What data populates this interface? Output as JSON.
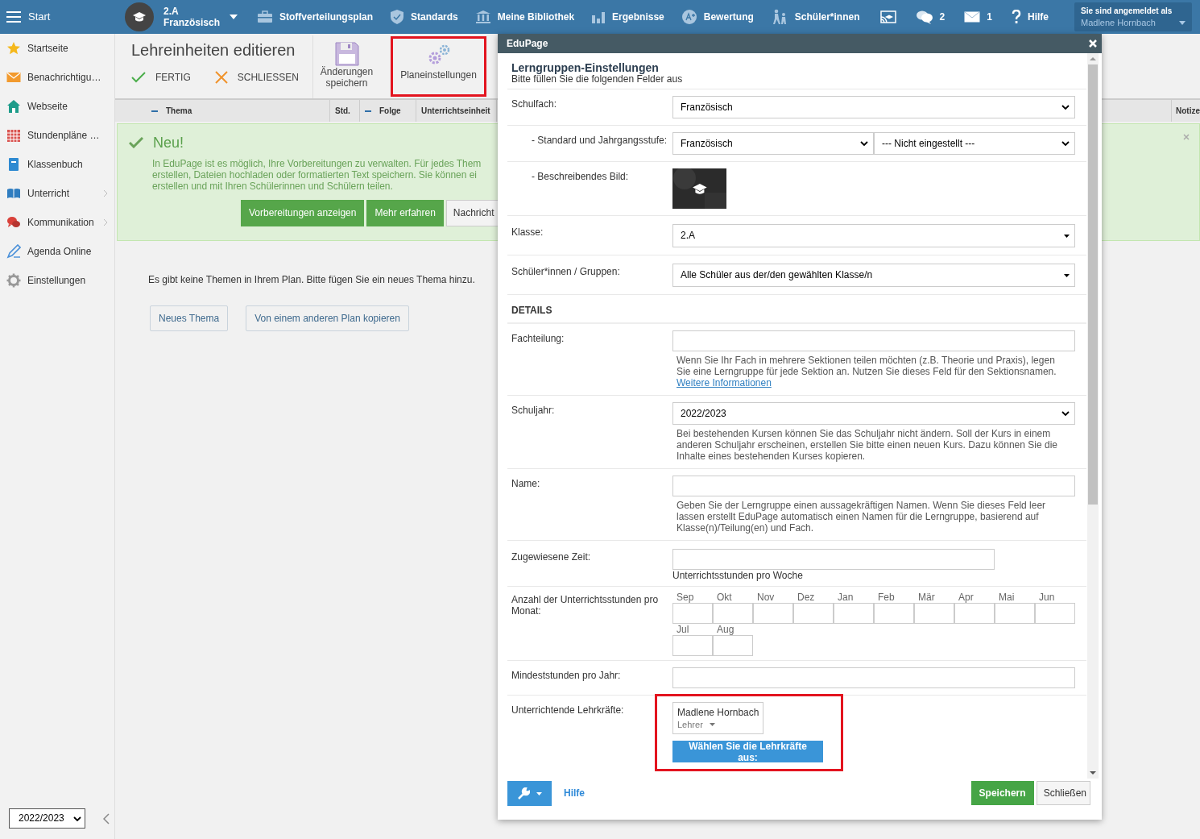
{
  "topbar": {
    "menu_label": "Start",
    "class_selector": {
      "line1": "2.A",
      "line2": "Französisch"
    },
    "nav": [
      {
        "label": "Stoffverteilungsplan"
      },
      {
        "label": "Standards"
      },
      {
        "label": "Meine Bibliothek"
      },
      {
        "label": "Ergebnisse"
      },
      {
        "label": "Bewertung"
      },
      {
        "label": "Schüler*innen"
      }
    ],
    "messages_count": "2",
    "mail_count": "1",
    "help_label": "Hilfe",
    "account": {
      "caption": "Sie sind angemeldet als",
      "user": "Madlene Hornbach"
    }
  },
  "sidebar": {
    "items": [
      {
        "label": "Startseite",
        "has_submenu": false
      },
      {
        "label": "Benachrichtigu…",
        "has_submenu": false
      },
      {
        "label": "Webseite",
        "has_submenu": false
      },
      {
        "label": "Stundenpläne …",
        "has_submenu": false
      },
      {
        "label": "Klassenbuch",
        "has_submenu": false
      },
      {
        "label": "Unterricht",
        "has_submenu": true
      },
      {
        "label": "Kommunikation",
        "has_submenu": true
      },
      {
        "label": "Agenda Online",
        "has_submenu": false
      },
      {
        "label": "Einstellungen",
        "has_submenu": false
      }
    ],
    "year_select": "2022/2023"
  },
  "toolbar": {
    "title": "Lehreinheiten editieren",
    "done": "FERTIG",
    "close": "SCHLIESSEN",
    "save": "Änderungen speichern",
    "plan_settings": {
      "label": "Planeinstellungen",
      "highlighted": true
    }
  },
  "table_header": {
    "columns": [
      {
        "label": "Thema",
        "collapse": true
      },
      {
        "label": "Std.",
        "collapse": false
      },
      {
        "label": "Folge",
        "collapse": true
      },
      {
        "label": "Unterrichtseinheit",
        "collapse": false
      }
    ],
    "last_column": "Notize"
  },
  "banner": {
    "title": "Neu!",
    "lines": [
      "In EduPage ist es möglich, Ihre Vorbereitungen zu verwalten. Für jedes Them",
      "erstellen, Dateien hochladen oder formatierten Text speichern. Sie können ei",
      "erstellen und mit Ihren Schülerinnen und Schülern teilen."
    ],
    "buttons": [
      {
        "label": "Vorbereitungen anzeigen",
        "kind": "primary"
      },
      {
        "label": "Mehr erfahren",
        "kind": "primary"
      },
      {
        "label": "Nachricht",
        "kind": "secondary"
      }
    ]
  },
  "empty_message": "Es gibt keine Themen in Ihrem Plan. Bitte fügen Sie ein neues Thema hinzu.",
  "actions": [
    "Neues Thema",
    "Von einem anderen Plan kopieren"
  ],
  "dialog": {
    "title": "EduPage",
    "heading": "Lerngruppen-Einstellungen",
    "subheading": "Bitte füllen Sie die folgenden Felder aus",
    "rows": [
      {
        "kind": "select",
        "label": "Schulfach:",
        "value": "Französisch",
        "children": [
          {
            "kind": "select_pair",
            "label": "- Standard und Jahrgangsstufe:",
            "values": [
              "Französisch",
              "--- Nicht eingestellt ---"
            ]
          },
          {
            "label": "- Beschreibendes Bild:"
          }
        ]
      },
      {
        "kind": "combo",
        "label": "Klasse:",
        "value": "2.A"
      },
      {
        "kind": "combo",
        "label": "Schüler*innen / Gruppen:",
        "value": "Alle Schüler aus der/den gewählten Klasse/n"
      },
      {
        "kind": "heading",
        "label": "DETAILS"
      },
      {
        "kind": "text",
        "label": "Fachteilung:",
        "help": "Wenn Sie Ihr Fach in mehrere Sektionen teilen möchten (z.B. Theorie und Praxis), legen Sie eine Lerngruppe für jede Sektion an. Nutzen Sie dieses Feld für den Sektionsnamen.",
        "link": "Weitere Informationen"
      },
      {
        "kind": "select",
        "label": "Schuljahr:",
        "value": "2022/2023",
        "help": "Bei bestehenden Kursen können Sie das Schuljahr nicht ändern. Soll der Kurs in einem anderen Schuljahr erscheinen, erstellen Sie bitte einen neuen Kurs. Dazu können Sie die Inhalte eines bestehenden Kurses kopieren."
      },
      {
        "kind": "text",
        "label": "Name:",
        "help": "Geben Sie der Lerngruppe einen aussagekräftigen Namen. Wenn Sie dieses Feld leer lassen erstellt EduPage automatisch einen Namen für die Lerngruppe, basierend auf Klasse(n)/Teilung(en) und Fach."
      },
      {
        "kind": "short_text",
        "label": "Zugewiesene Zeit:",
        "note": "Unterrichtsstunden pro Woche"
      },
      {
        "kind": "months",
        "label": "Anzahl der Unterrichtsstunden pro Monat:",
        "months": [
          "Sep",
          "Okt",
          "Nov",
          "Dez",
          "Jan",
          "Feb",
          "Mär",
          "Apr",
          "Mai",
          "Jun",
          "Jul",
          "Aug"
        ]
      },
      {
        "kind": "text",
        "label": "Mindeststunden pro Jahr:"
      },
      {
        "kind": "teachers",
        "label": "Unterrichtende Lehrkräfte:",
        "teachers": [
          {
            "name": "Madlene Hornbach",
            "role": "Lehrer"
          }
        ],
        "button": "Wählen Sie die Lehrkräfte aus:",
        "highlighted": true
      }
    ],
    "help_link": "Hilfe",
    "save": "Speichern",
    "close": "Schließen"
  }
}
